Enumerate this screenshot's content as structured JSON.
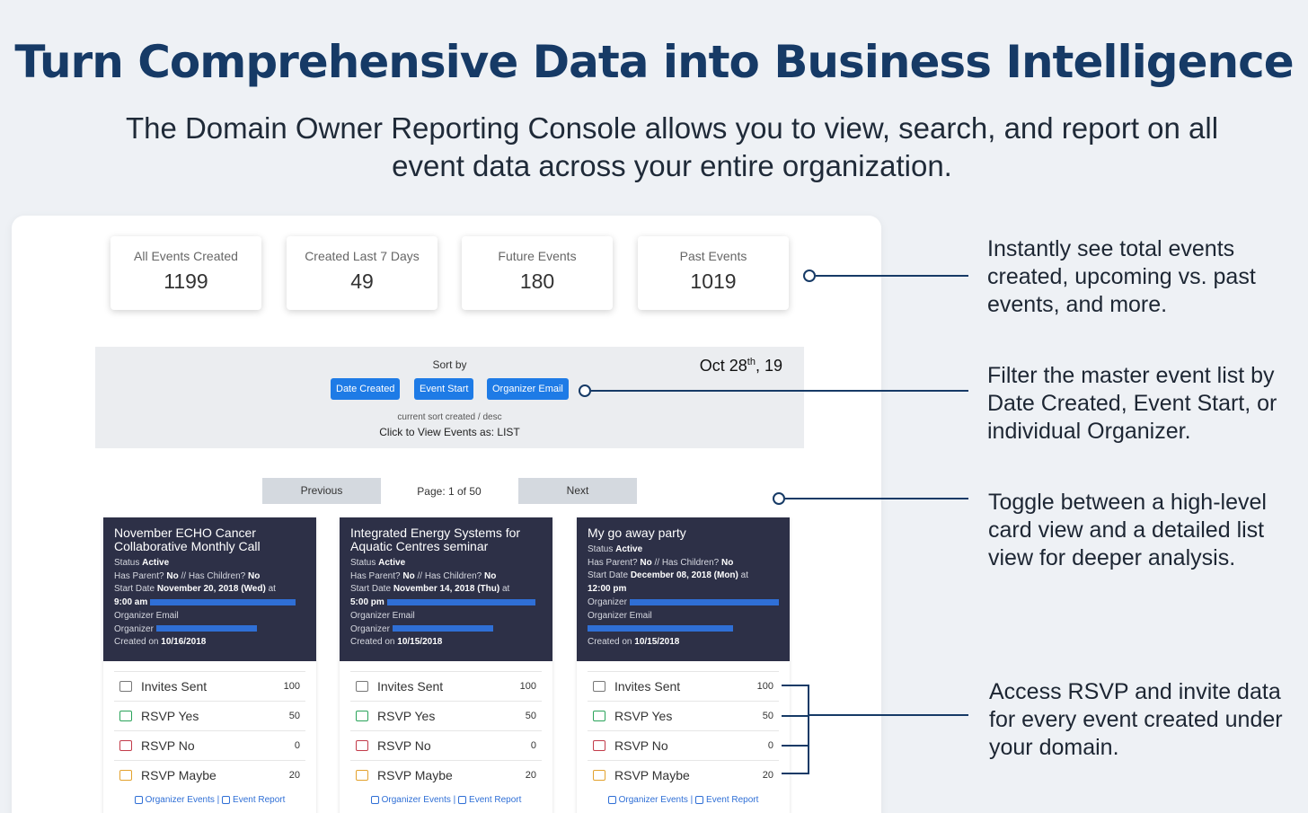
{
  "hero": {
    "title": "Turn Comprehensive Data into Business Intelligence",
    "subtitle": "The Domain Owner Reporting Console allows you to view, search, and report on all event data across your entire organization."
  },
  "stats": [
    {
      "label": "All Events Created",
      "value": "1199"
    },
    {
      "label": "Created Last 7 Days",
      "value": "49"
    },
    {
      "label": "Future Events",
      "value": "180"
    },
    {
      "label": "Past Events",
      "value": "1019"
    }
  ],
  "sort": {
    "label": "Sort by",
    "date": "Oct 28",
    "date_suffix": "th",
    "date_year": ", 19",
    "buttons": [
      "Date Created",
      "Event Start",
      "Organizer Email"
    ],
    "current": "current sort created / desc",
    "view_toggle": "Click to View Events as: LIST"
  },
  "pagination": {
    "previous": "Previous",
    "page": "Page: 1 of 50",
    "next": "Next"
  },
  "cards": [
    {
      "title": "November ECHO Cancer Collaborative Monthly Call",
      "status_label": "Status",
      "status": "Active",
      "parent_label": "Has Parent?",
      "parent": "No",
      "children_label": "// Has Children?",
      "children": "No",
      "start_label": "Start Date",
      "start": "November 20, 2018 (Wed)",
      "start_at": "at",
      "time": "9:00 am",
      "email_label": "Organizer Email",
      "organizer_label": "Organizer",
      "created_label": "Created on",
      "created": "10/16/2018",
      "metrics": [
        {
          "label": "Invites Sent",
          "value": "100"
        },
        {
          "label": "RSVP Yes",
          "value": "50"
        },
        {
          "label": "RSVP No",
          "value": "0"
        },
        {
          "label": "RSVP Maybe",
          "value": "20"
        }
      ],
      "foot_a": "Organizer Events",
      "foot_sep": "|",
      "foot_b": "Event Report"
    },
    {
      "title": "Integrated Energy Systems for Aquatic Centres seminar",
      "status_label": "Status",
      "status": "Active",
      "parent_label": "Has Parent?",
      "parent": "No",
      "children_label": "// Has Children?",
      "children": "No",
      "start_label": "Start Date",
      "start": "November 14, 2018 (Thu)",
      "start_at": "at",
      "time": "5:00 pm",
      "email_label": "Organizer Email",
      "organizer_label": "Organizer",
      "created_label": "Created on",
      "created": "10/15/2018",
      "metrics": [
        {
          "label": "Invites Sent",
          "value": "100"
        },
        {
          "label": "RSVP Yes",
          "value": "50"
        },
        {
          "label": "RSVP No",
          "value": "0"
        },
        {
          "label": "RSVP Maybe",
          "value": "20"
        }
      ],
      "foot_a": "Organizer Events",
      "foot_sep": "|",
      "foot_b": "Event Report"
    },
    {
      "title": "My go away party",
      "status_label": "Status",
      "status": "Active",
      "parent_label": "Has Parent?",
      "parent": "No",
      "children_label": "// Has Children?",
      "children": "No",
      "start_label": "Start Date",
      "start": "December 08, 2018 (Mon)",
      "start_at": "at",
      "time": "12:00 pm",
      "email_label": "Organizer",
      "organizer_label": "Organizer Email",
      "created_label": "Created on",
      "created": "10/15/2018",
      "metrics": [
        {
          "label": "Invites Sent",
          "value": "100"
        },
        {
          "label": "RSVP Yes",
          "value": "50"
        },
        {
          "label": "RSVP No",
          "value": "0"
        },
        {
          "label": "RSVP Maybe",
          "value": "20"
        }
      ],
      "foot_a": "Organizer Events",
      "foot_sep": "|",
      "foot_b": "Event Report"
    }
  ],
  "callouts": [
    "Instantly see total events created, upcoming vs. past events, and more.",
    "Filter the master event list by Date Created, Event Start, or individual Organizer.",
    "Toggle between a high-level card view and a detailed list view for deeper analysis.",
    "Access RSVP and invite data for every event created under your domain."
  ],
  "colors": {
    "title": "#163a66",
    "button": "#1e7be6",
    "card_header": "#2d3047",
    "rsvp_yes": "#2aa35a",
    "rsvp_no": "#c23b4a",
    "rsvp_maybe": "#e3a22e"
  }
}
